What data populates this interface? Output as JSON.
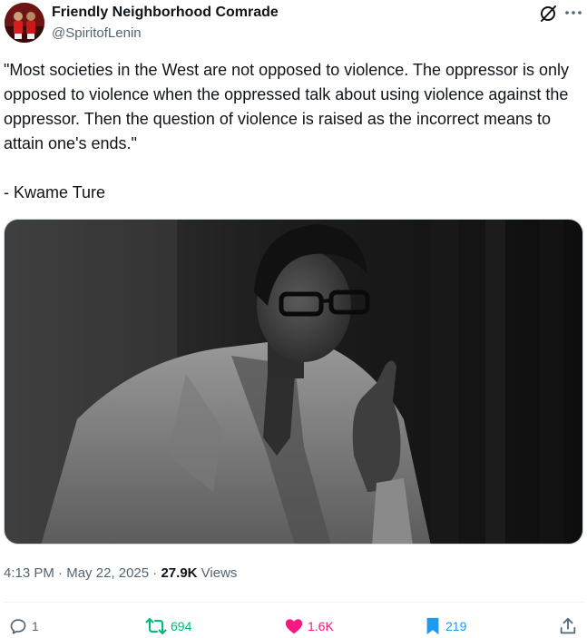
{
  "author": {
    "display_name": "Friendly Neighborhood Comrade",
    "handle": "@SpiritofLenin"
  },
  "tweet": {
    "quote": "\"Most societies in the West are not opposed to violence. The oppressor is only opposed to violence when the oppressed talk about using violence against the oppressor. Then the question of violence is raised as the incorrect means to attain one's ends.\"",
    "attribution": "- Kwame Ture"
  },
  "meta": {
    "time": "4:13 PM",
    "separator": "·",
    "date": "May 22, 2025",
    "views_count": "27.9K",
    "views_label": "Views"
  },
  "actions": {
    "reply_count": "1",
    "retweet_count": "694",
    "like_count": "1.6K",
    "bookmark_count": "219"
  },
  "icons": {
    "header": [
      "grok-icon",
      "more-icon"
    ],
    "actions": [
      "reply-icon",
      "retweet-icon",
      "like-icon",
      "bookmark-icon",
      "share-icon"
    ]
  },
  "colors": {
    "text_primary": "#0f1419",
    "text_secondary": "#536471",
    "retweet_active": "#00ba7c",
    "like_active": "#f91880",
    "bookmark_active": "#1d9bf0"
  }
}
